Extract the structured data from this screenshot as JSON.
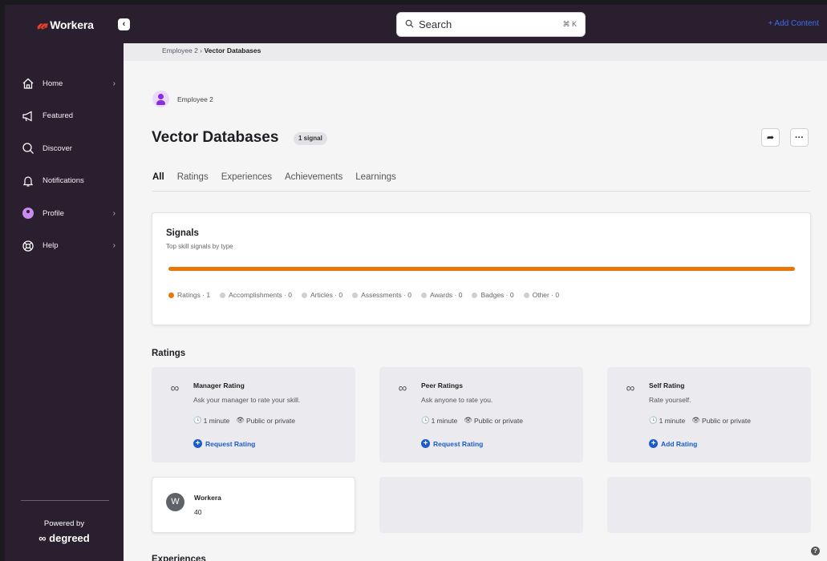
{
  "topbar": {
    "brand": "Workera",
    "search_placeholder": "Search",
    "search_shortcut": "⌘ K",
    "add_content": "+ Add Content"
  },
  "sidebar": {
    "items": [
      {
        "label": "Home",
        "icon": "home-icon",
        "has_chevron": true
      },
      {
        "label": "Featured",
        "icon": "megaphone-icon",
        "has_chevron": false
      },
      {
        "label": "Discover",
        "icon": "search-icon",
        "has_chevron": false
      },
      {
        "label": "Notifications",
        "icon": "bell-icon",
        "has_chevron": false
      },
      {
        "label": "Profile",
        "icon": "profile-avatar-icon",
        "has_chevron": true
      },
      {
        "label": "Help",
        "icon": "lifebuoy-icon",
        "has_chevron": true
      }
    ],
    "powered_by": "Powered by",
    "degreed_logo": "degreed"
  },
  "breadcrumb": {
    "parent": "Employee 2",
    "separator": "›",
    "current": "Vector Databases"
  },
  "profile": {
    "employee_name": "Employee 2"
  },
  "page": {
    "title": "Vector Databases",
    "signal_badge": "1 signal"
  },
  "tabs": [
    "All",
    "Ratings",
    "Experiences",
    "Achievements",
    "Learnings"
  ],
  "active_tab": "All",
  "signals": {
    "title": "Signals",
    "subtitle": "Top skill signals by type",
    "bar_fill_fraction": 1.0,
    "legend": [
      {
        "label": "Ratings",
        "count": "1",
        "color": "#e8760a"
      },
      {
        "label": "Accomplishments",
        "count": "0",
        "color": "#cfcfd4"
      },
      {
        "label": "Articles",
        "count": "0",
        "color": "#cfcfd4"
      },
      {
        "label": "Assessments",
        "count": "0",
        "color": "#cfcfd4"
      },
      {
        "label": "Awards",
        "count": "0",
        "color": "#cfcfd4"
      },
      {
        "label": "Badges",
        "count": "0",
        "color": "#cfcfd4"
      },
      {
        "label": "Other",
        "count": "0",
        "color": "#cfcfd4"
      }
    ]
  },
  "ratings": {
    "heading": "Ratings",
    "cards": [
      {
        "title": "Manager Rating",
        "desc": "Ask your manager to rate your skill.",
        "time": "1 minute",
        "visibility": "Public or private",
        "action": "Request Rating"
      },
      {
        "title": "Peer Ratings",
        "desc": "Ask anyone to rate you.",
        "time": "1 minute",
        "visibility": "Public or private",
        "action": "Request Rating"
      },
      {
        "title": "Self Rating",
        "desc": "Rate yourself.",
        "time": "1 minute",
        "visibility": "Public or private",
        "action": "Add Rating"
      }
    ],
    "result": {
      "initial": "W",
      "name": "Workera",
      "value": "40"
    }
  },
  "experiences": {
    "heading": "Experiences"
  },
  "help_button": "?",
  "colors": {
    "sidebar_bg": "#2a1f2e",
    "accent_orange": "#e8760a",
    "link_blue": "#1a5cc9",
    "brand_red": "#e8412b"
  }
}
